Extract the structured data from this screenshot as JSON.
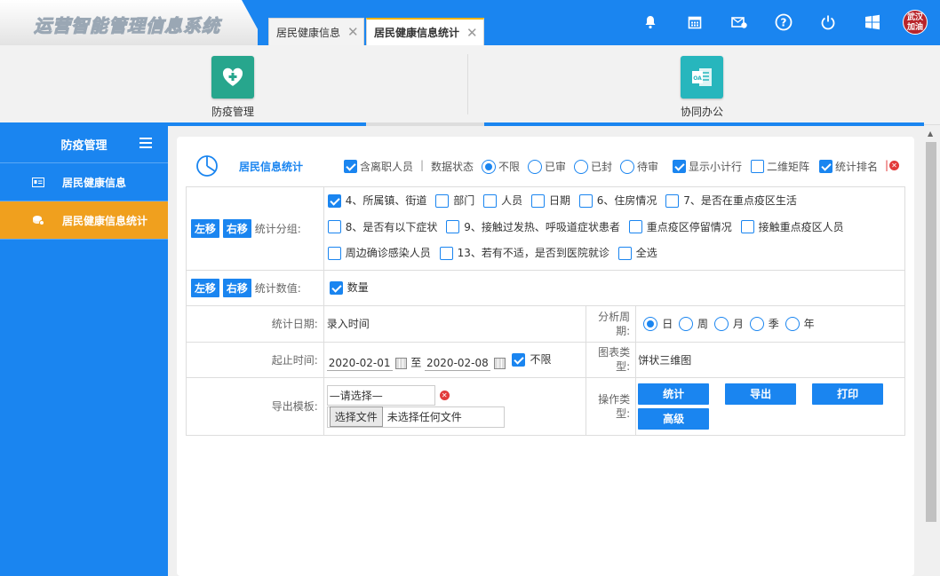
{
  "app": {
    "title": "运营智能管理信息系统"
  },
  "tabs": [
    {
      "label": "居民健康信息"
    },
    {
      "label": "居民健康信息统计"
    }
  ],
  "user": {
    "avatar_text": "武汉加油"
  },
  "modules": [
    {
      "label": "防疫管理",
      "color": "#27a68d"
    },
    {
      "label": "协同办公",
      "color": "#27b6bd"
    }
  ],
  "sidebar": {
    "title": "防疫管理",
    "items": [
      {
        "label": "居民健康信息"
      },
      {
        "label": "居民健康信息统计"
      }
    ]
  },
  "panel": {
    "title": "居民信息统计",
    "options": {
      "include_departed": "含离职人员",
      "data_status_label": "数据状态",
      "status_options": [
        "不限",
        "已审",
        "已封",
        "待审"
      ],
      "show_subtotal": "显示小计行",
      "two_dim_matrix": "二维矩阵",
      "stat_rank": "统计排名"
    },
    "group": {
      "left_btn": "左移",
      "right_btn": "右移",
      "label": "统计分组:",
      "items": [
        {
          "label": "4、所属镇、街道",
          "checked": true
        },
        {
          "label": "部门",
          "checked": false
        },
        {
          "label": "人员",
          "checked": false
        },
        {
          "label": "日期",
          "checked": false
        },
        {
          "label": "6、住房情况",
          "checked": false
        },
        {
          "label": "7、是否在重点疫区生活",
          "checked": false
        },
        {
          "label": "8、是否有以下症状",
          "checked": false
        },
        {
          "label": "9、接触过发热、呼吸道症状患者",
          "checked": false
        },
        {
          "label": "重点疫区停留情况",
          "checked": false
        },
        {
          "label": "接触重点疫区人员",
          "checked": false
        },
        {
          "label": "周边确诊感染人员",
          "checked": false
        },
        {
          "label": "13、若有不适，是否到医院就诊",
          "checked": false
        },
        {
          "label": "全选",
          "checked": false
        }
      ]
    },
    "values": {
      "label": "统计数值:",
      "items": [
        {
          "label": "数量",
          "checked": true
        }
      ]
    },
    "stat_date": {
      "label": "统计日期:",
      "value": "录入时间"
    },
    "period": {
      "label": "分析周期:",
      "options": [
        "日",
        "周",
        "月",
        "季",
        "年"
      ],
      "selected": "日"
    },
    "range": {
      "label": "起止时间:",
      "start": "2020-02-01",
      "to": "至",
      "end": "2020-02-08",
      "unlimited": "不限"
    },
    "chart_type": {
      "label": "图表类型:",
      "value": "饼状三维图"
    },
    "export_tpl": {
      "label": "导出模板:",
      "select_value": "—请选择—",
      "file_button": "选择文件",
      "file_status": "未选择任何文件"
    },
    "actions": {
      "label": "操作类型:",
      "buttons": [
        "统计",
        "导出",
        "打印",
        "高级"
      ]
    }
  },
  "colors": {
    "primary": "#1a85f0",
    "active_tab_accent": "#f0b400",
    "sidebar_active": "#f0a01e"
  }
}
